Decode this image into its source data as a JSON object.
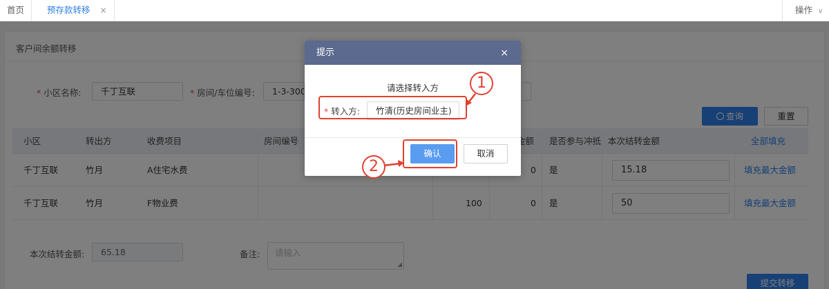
{
  "tabs": {
    "home": "首页",
    "active": "预存款转移",
    "close": "×",
    "operations": "操作",
    "operations_chevron": "∨"
  },
  "panel": {
    "title": "客户间余额转移"
  },
  "form": {
    "community_label": "小区名称:",
    "community_value": "千丁互联",
    "room_label": "房间/车位编号:",
    "room_value": "1-3-3002",
    "query_button": "查询",
    "reset_button": "重置"
  },
  "table": {
    "headers": [
      "小区",
      "转出方",
      "收费项目",
      "房间编号",
      "金额",
      "是否参与冲抵",
      "本次结转金额",
      "全部填充"
    ],
    "rows": [
      {
        "community": "千丁互联",
        "from": "竹月",
        "item": "A住宅水费",
        "room": "",
        "amount": "",
        "offset_amount": "0",
        "participate": "是",
        "transfer": "15.18",
        "action": "填充最大金额"
      },
      {
        "community": "千丁互联",
        "from": "竹月",
        "item": "F物业费",
        "room": "",
        "amount": "100",
        "offset_amount": "0",
        "participate": "是",
        "transfer": "50",
        "action": "填充最大金额"
      }
    ]
  },
  "summary": {
    "total_label": "本次结转金额:",
    "total_value": "65.18",
    "remark_label": "备注:",
    "remark_placeholder": "请输入",
    "submit_button": "提交转移"
  },
  "dialog": {
    "title": "提示",
    "close": "×",
    "message": "请选择转入方",
    "transferee_label": "转入方:",
    "transferee_value": "竹清(历史房间业主)",
    "confirm_button": "确认",
    "cancel_button": "取消"
  },
  "annotations": {
    "step1": "1",
    "step2": "2"
  },
  "colors": {
    "primary": "#2f80ed",
    "dialog_header": "#5b6a8e",
    "annotation": "#e0402f",
    "required": "#e54545"
  }
}
